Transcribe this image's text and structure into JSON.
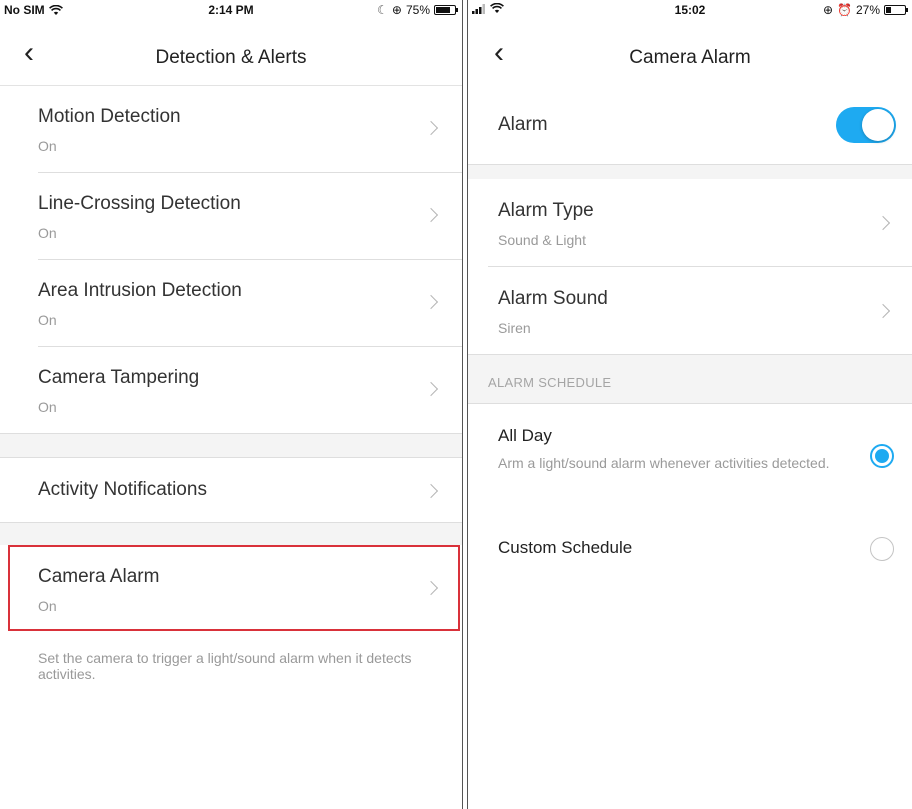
{
  "left": {
    "status": {
      "carrier": "No SIM",
      "time": "2:14 PM",
      "battery": "75%",
      "battery_level": 0.75
    },
    "nav": {
      "title": "Detection & Alerts"
    },
    "items": [
      {
        "label": "Motion Detection",
        "value": "On"
      },
      {
        "label": "Line-Crossing Detection",
        "value": "On"
      },
      {
        "label": "Area Intrusion Detection",
        "value": "On"
      },
      {
        "label": "Camera Tampering",
        "value": "On"
      },
      {
        "label": "Activity Notifications"
      },
      {
        "label": "Camera Alarm",
        "value": "On"
      }
    ],
    "alarm_hint": "Set the camera to trigger a light/sound alarm when it detects activities."
  },
  "right": {
    "status": {
      "time": "15:02",
      "battery": "27%",
      "battery_level": 0.27
    },
    "nav": {
      "title": "Camera Alarm"
    },
    "alarm": {
      "label": "Alarm",
      "enabled": true
    },
    "alarm_type": {
      "label": "Alarm Type",
      "value": "Sound & Light"
    },
    "alarm_sound": {
      "label": "Alarm Sound",
      "value": "Siren"
    },
    "schedule_header": "ALARM SCHEDULE",
    "schedule": {
      "all_day": {
        "label": "All Day",
        "desc": "Arm a light/sound alarm whenever activities detected.",
        "selected": true
      },
      "custom": {
        "label": "Custom Schedule",
        "selected": false
      }
    }
  },
  "colors": {
    "accent": "#1eaaf1",
    "highlight": "#d9313a"
  }
}
